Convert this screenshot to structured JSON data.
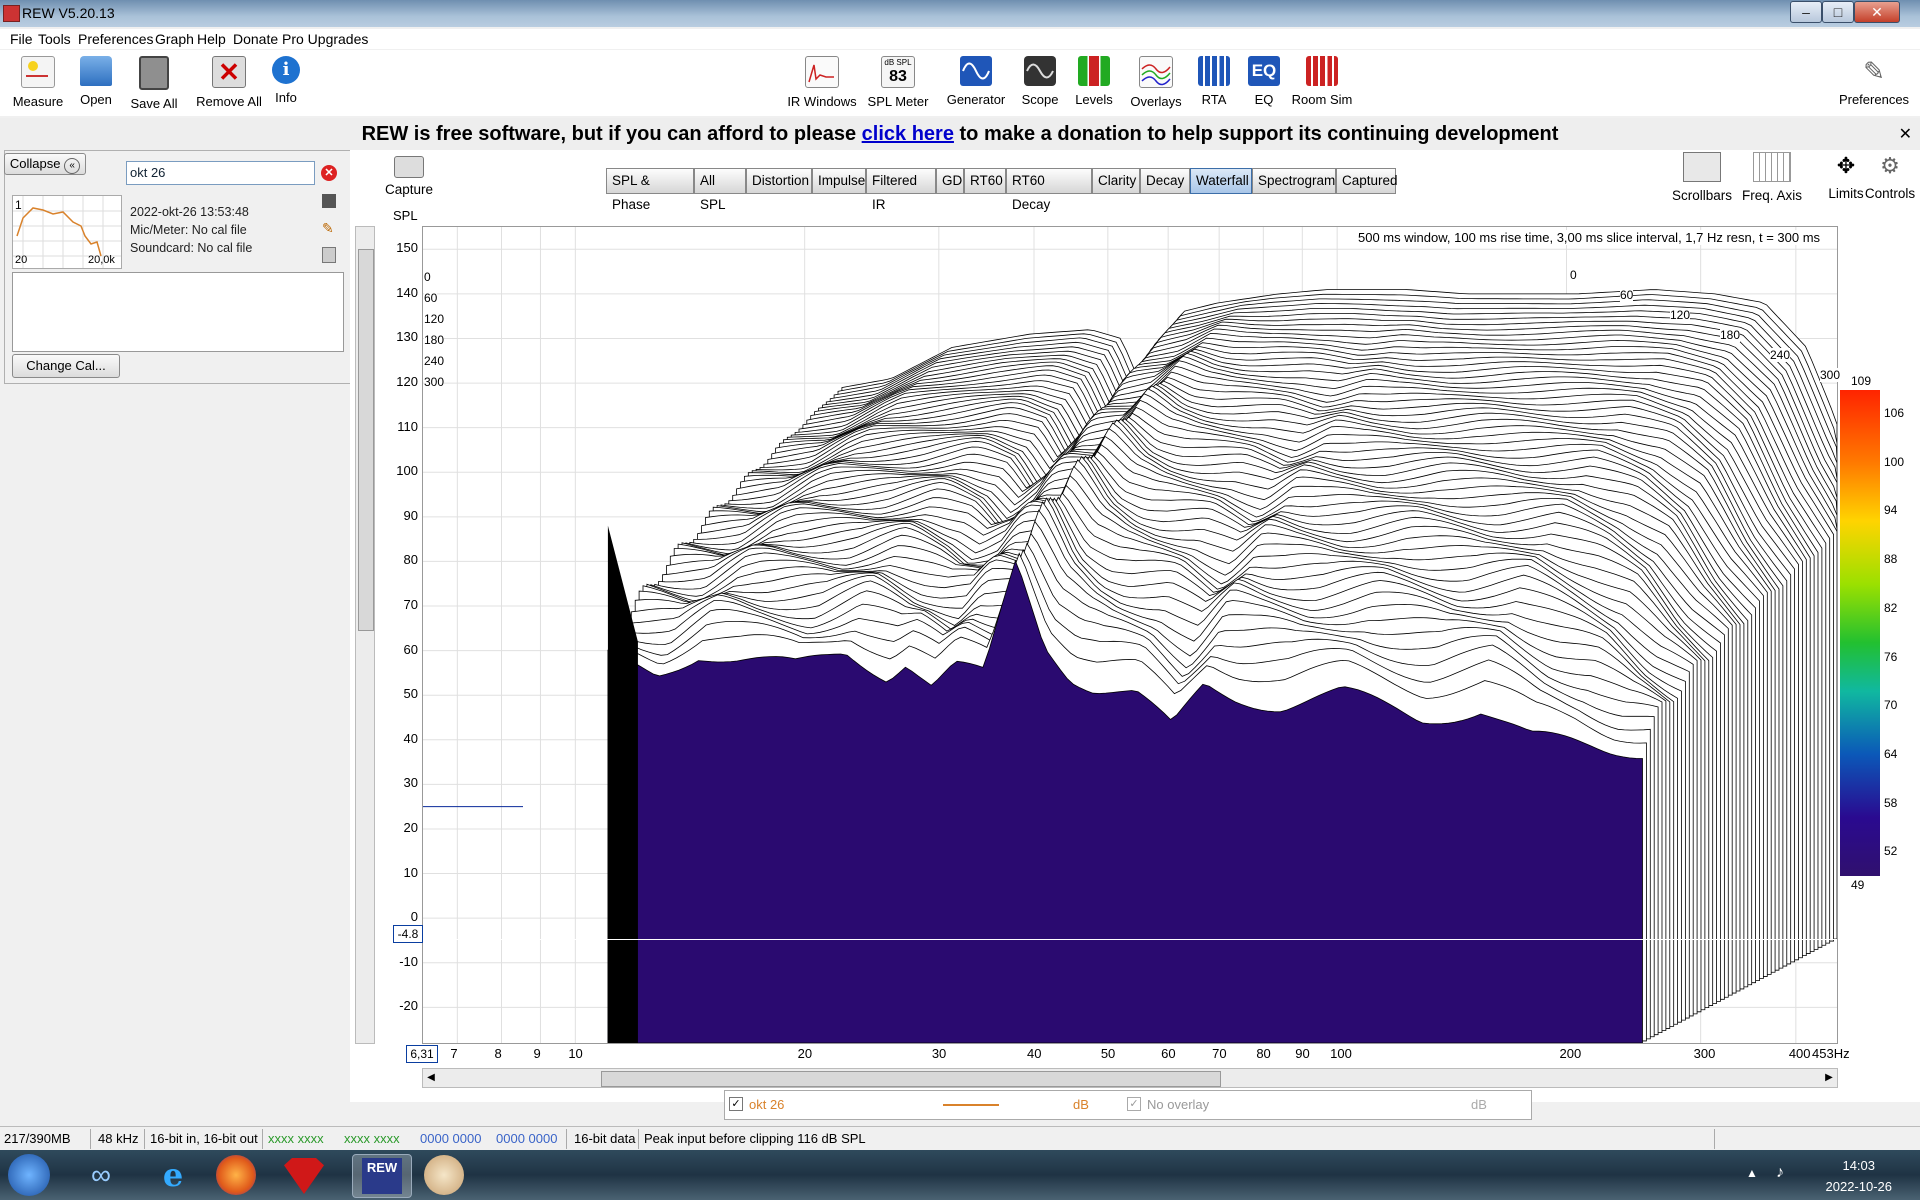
{
  "window": {
    "title": "REW V5.20.13"
  },
  "menu": [
    "File",
    "Tools",
    "Preferences",
    "Graph",
    "Help",
    "Donate",
    "Pro Upgrades"
  ],
  "toolbar_left": [
    {
      "label": "Measure",
      "icon": "measure-icon"
    },
    {
      "label": "Open",
      "icon": "folder-icon"
    },
    {
      "label": "Save All",
      "icon": "save-icon"
    },
    {
      "label": "Remove All",
      "icon": "remove-icon"
    },
    {
      "label": "Info",
      "icon": "info-icon"
    }
  ],
  "toolbar_center": [
    {
      "label": "IR Windows",
      "icon": "ir-windows-icon"
    },
    {
      "label": "SPL Meter",
      "icon": "spl-meter-icon",
      "badge_top": "dB SPL",
      "badge": "83"
    },
    {
      "label": "Generator",
      "icon": "generator-icon"
    },
    {
      "label": "Scope",
      "icon": "scope-icon"
    },
    {
      "label": "Levels",
      "icon": "levels-icon"
    },
    {
      "label": "Overlays",
      "icon": "overlays-icon"
    },
    {
      "label": "RTA",
      "icon": "rta-icon"
    },
    {
      "label": "EQ",
      "icon": "eq-icon"
    },
    {
      "label": "Room Sim",
      "icon": "room-sim-icon"
    }
  ],
  "toolbar_right": {
    "label": "Preferences",
    "icon": "wrench-icon"
  },
  "donation": {
    "before": "REW is free software, but if you can afford to please ",
    "link": "click here",
    "after": " to make a donation to help support its continuing development",
    "close": "✕"
  },
  "left_panel": {
    "collapse_label": "Collapse",
    "collapse_glyph": "«",
    "filter_value": "okt 26",
    "measurement": {
      "index": "1",
      "date": "2022-okt-26 13:53:48",
      "mic": "Mic/Meter: No cal file",
      "soundcard": "Soundcard: No cal file",
      "thumb_x_min": "20",
      "thumb_x_max": "20,0k"
    },
    "change_cal_label": "Change Cal..."
  },
  "graph": {
    "capture_label": "Capture",
    "y_axis_label": "SPL",
    "tabs": [
      "SPL & Phase",
      "All SPL",
      "Distortion",
      "Impulse",
      "Filtered IR",
      "GD",
      "RT60",
      "RT60 Decay",
      "Clarity",
      "Decay",
      "Waterfall",
      "Spectrogram",
      "Captured"
    ],
    "active_tab": "Waterfall",
    "side_tools": [
      {
        "label": "Scrollbars",
        "icon": "scrollbars-icon"
      },
      {
        "label": "Freq. Axis",
        "icon": "freq-axis-icon"
      },
      {
        "label": "Limits",
        "icon": "limits-icon"
      },
      {
        "label": "Controls",
        "icon": "controls-icon"
      }
    ],
    "info_text": "500 ms window, 100 ms rise time, 3,00 ms slice interval, 1,7 Hz resn, t = 300 ms",
    "y_cursor_value": "-4.8",
    "x_cursor_value": "6,31",
    "x_end_label": "453Hz"
  },
  "chart_data": {
    "type": "area",
    "title": "",
    "subtitle": "500 ms window, 100 ms rise time, 3,00 ms slice interval, 1,7 Hz resn, t = 300 ms",
    "xlabel": "",
    "ylabel": "SPL",
    "xscale": "log",
    "xlim": [
      6.31,
      453
    ],
    "ylim": [
      -28,
      155
    ],
    "y_ticks": [
      150,
      140,
      130,
      120,
      110,
      100,
      90,
      80,
      70,
      60,
      50,
      40,
      30,
      20,
      10,
      0,
      -10,
      -20
    ],
    "x_ticks": [
      7,
      8,
      9,
      10,
      20,
      30,
      40,
      50,
      60,
      70,
      80,
      90,
      100,
      200,
      300,
      400
    ],
    "x_ticks_labels": [
      "7",
      "8",
      "9",
      "10",
      "20",
      "30",
      "40",
      "50",
      "60",
      "70",
      "80",
      "90",
      "100",
      "200",
      "300",
      "400"
    ],
    "time_ticks_ms": [
      "0",
      "60",
      "120",
      "180",
      "240",
      "300"
    ],
    "time_ticks_left": [
      "0",
      "60",
      "120",
      "180",
      "240",
      "300"
    ],
    "colorbar": {
      "max": "109",
      "min": "49",
      "ticks": [
        "106",
        "100",
        "94",
        "88",
        "82",
        "76",
        "70",
        "64",
        "58",
        "52"
      ]
    },
    "front_slice_t300ms": {
      "x": [
        10,
        12,
        14,
        16,
        20,
        24,
        28,
        30,
        33,
        36,
        40,
        45,
        50,
        55,
        60,
        70,
        80,
        90,
        100,
        120,
        150,
        200,
        250,
        300,
        400,
        453
      ],
      "y": [
        58,
        55,
        60,
        58,
        56,
        60,
        55,
        58,
        52,
        56,
        54,
        80,
        62,
        55,
        52,
        50,
        42,
        52,
        50,
        48,
        50,
        45,
        47,
        40,
        38,
        38
      ]
    },
    "back_slice_t0ms": {
      "x": [
        10,
        12,
        15,
        20,
        25,
        28,
        30,
        35,
        40,
        50,
        60,
        70,
        80,
        100,
        150,
        200,
        250,
        300,
        350,
        400,
        453
      ],
      "y": [
        91,
        93,
        100,
        103,
        104,
        102,
        92,
        108,
        110,
        112,
        113,
        113,
        113,
        112,
        112,
        113,
        112,
        110,
        100,
        80,
        66
      ]
    },
    "grid": true,
    "legend": "none"
  },
  "legend_bar": {
    "name": "okt 26",
    "unit": "dB",
    "overlay": "No overlay",
    "overlay_unit": "dB",
    "color": "#d9822b"
  },
  "status": [
    "217/390MB",
    "48 kHz",
    "16-bit in, 16-bit out",
    "xxxx xxxx",
    "xxxx xxxx",
    "0000 0000",
    "0000 0000",
    "16-bit data",
    "Peak input before clipping 116 dB SPL"
  ],
  "clock": {
    "time": "14:03",
    "date": "2022-10-26"
  },
  "colors": {
    "accent": "#3c6ea8",
    "waterfall_fill": "#2a0a70",
    "link": "#0000cc"
  }
}
